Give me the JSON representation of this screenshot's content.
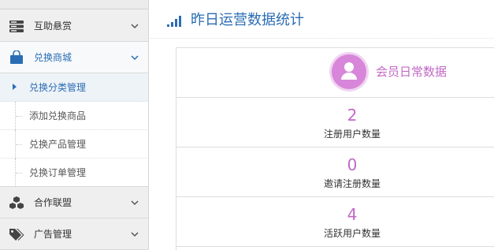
{
  "sidebar": {
    "menu": [
      {
        "label": "互助悬赏",
        "icon": "server-icon"
      },
      {
        "label": "兑换商城",
        "icon": "shopping-bag-icon"
      },
      {
        "label": "合作联盟",
        "icon": "cubes-icon"
      },
      {
        "label": "广告管理",
        "icon": "tags-icon"
      }
    ],
    "submenu": [
      {
        "label": "兑换分类管理",
        "selected": true
      },
      {
        "label": "添加兑换商品"
      },
      {
        "label": "兑换产品管理"
      },
      {
        "label": "兑换订单管理"
      }
    ]
  },
  "main": {
    "title": "昨日运营数据统计",
    "section_label": "会员日常数据",
    "stats": [
      {
        "value": "2",
        "label": "注册用户数量"
      },
      {
        "value": "0",
        "label": "邀请注册数量"
      },
      {
        "value": "4",
        "label": "活跃用户数量"
      }
    ]
  },
  "colors": {
    "accent_blue": "#2a6db4",
    "stat_purple": "#c268c7",
    "avatar_bg": "#d786d9"
  }
}
